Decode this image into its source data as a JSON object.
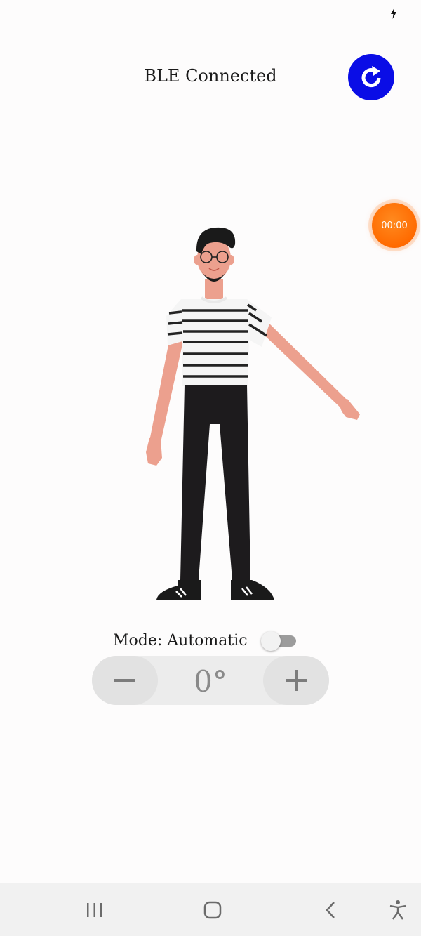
{
  "status_bar": {
    "charging_icon": "charging-bolt-icon"
  },
  "header": {
    "title": "BLE Connected",
    "refresh_icon": "refresh-icon",
    "refresh_color": "#0a0de6"
  },
  "timer": {
    "label": "00:00",
    "color": "#ff6a00"
  },
  "figure": {
    "icon": "standing-person-illustration"
  },
  "controls": {
    "mode_label": "Mode: Automatic",
    "mode_enabled": false,
    "decrement_icon": "minus-icon",
    "increment_icon": "plus-icon",
    "angle_value": "0°"
  },
  "nav_bar": {
    "recents_icon": "recents-icon",
    "home_icon": "home-icon",
    "back_icon": "back-icon",
    "accessibility_icon": "accessibility-icon"
  }
}
